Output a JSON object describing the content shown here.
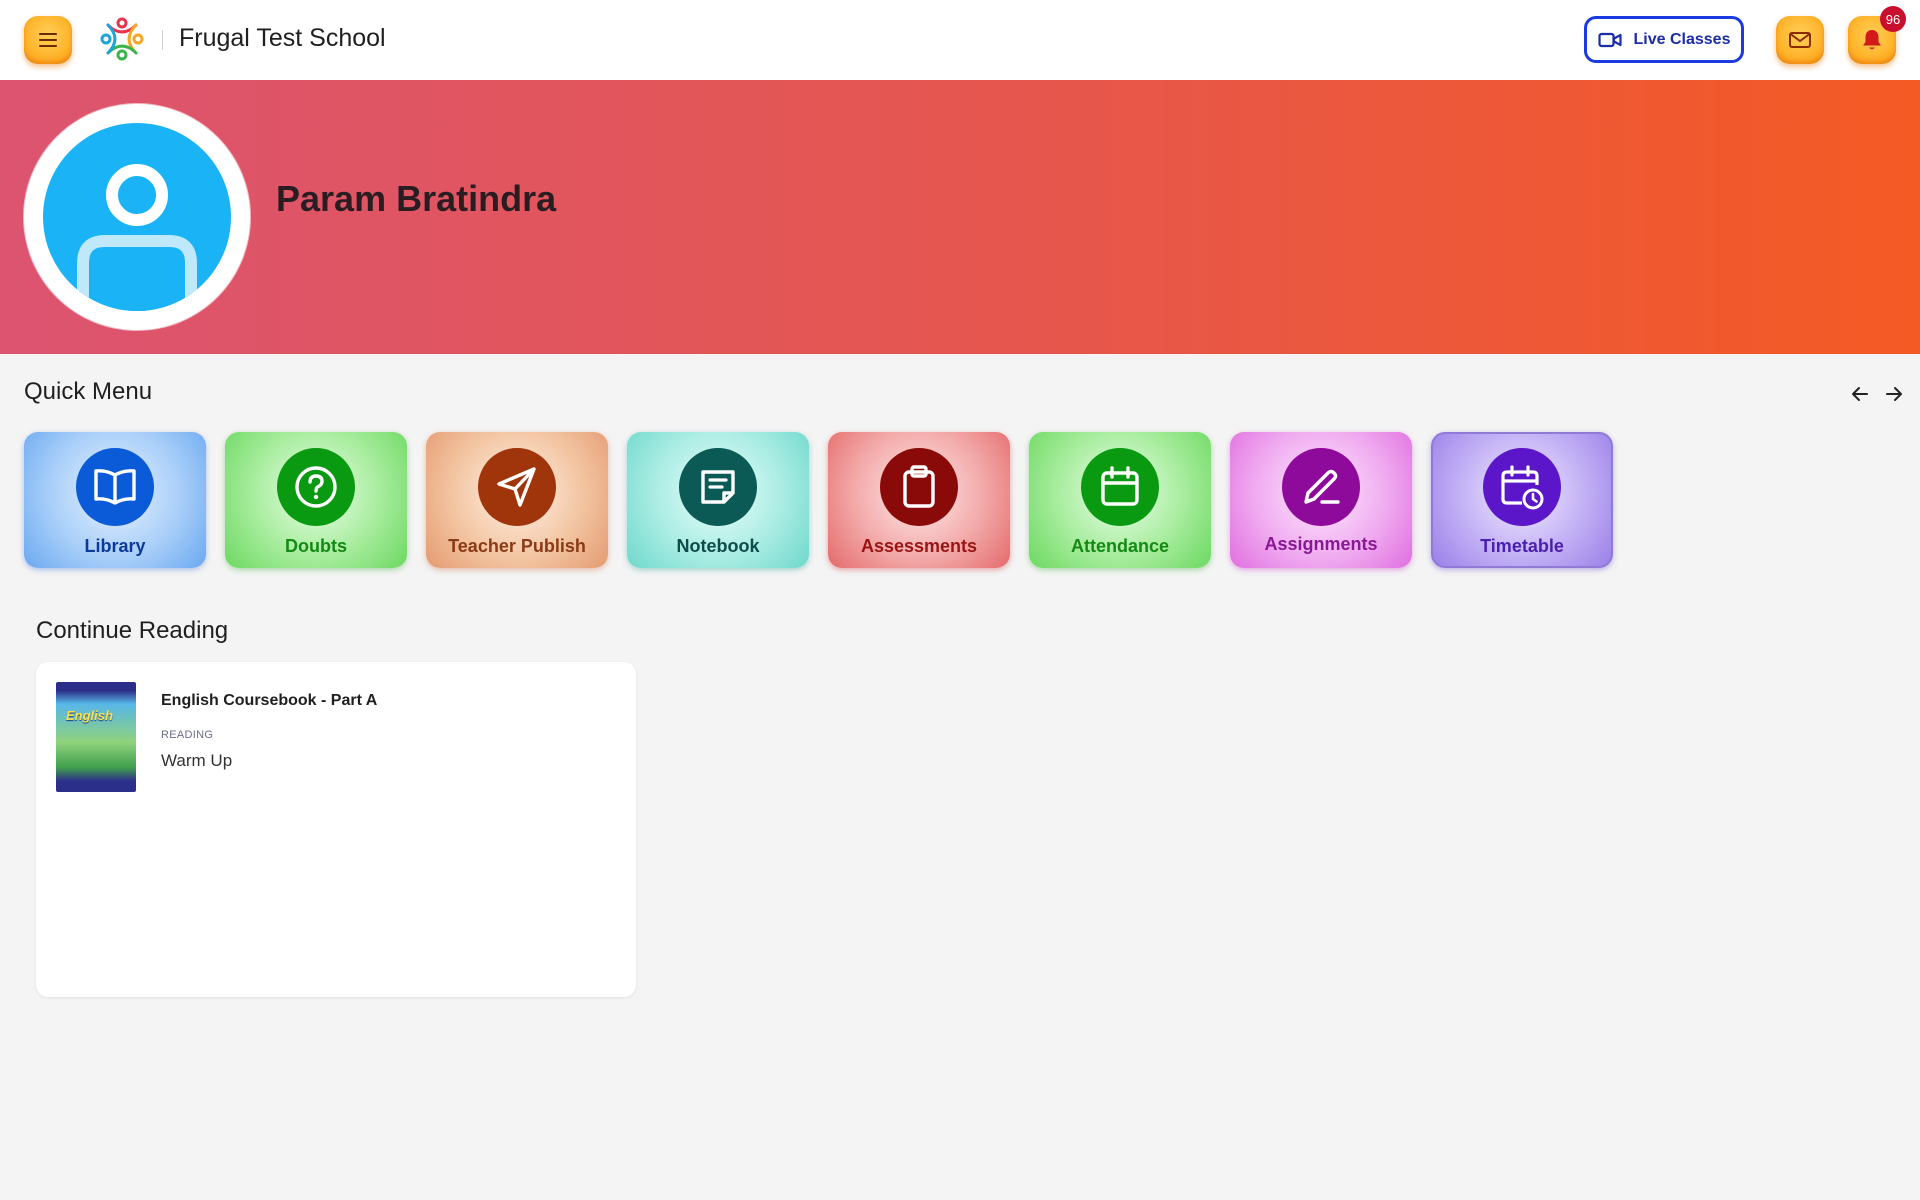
{
  "header": {
    "school_name": "Frugal Test School",
    "live_classes_label": "Live Classes",
    "notification_count": "96",
    "menu_icon": "hamburger-icon",
    "mail_icon": "mail-icon",
    "bell_icon": "bell-icon",
    "accent_color": "#1a3be0",
    "button_color": "#ffb42a"
  },
  "profile": {
    "name": "Param Bratindra",
    "avatar_icon": "user-avatar-icon",
    "banner_gradient": [
      "#dc5470",
      "#f45a24"
    ]
  },
  "quick_menu": {
    "title": "Quick Menu",
    "prev_icon": "arrow-left-icon",
    "next_icon": "arrow-right-icon",
    "items": [
      {
        "label": "Library",
        "icon": "book-icon"
      },
      {
        "label": "Doubts",
        "icon": "question-icon"
      },
      {
        "label": "Teacher Publish",
        "icon": "send-icon"
      },
      {
        "label": "Notebook",
        "icon": "note-icon"
      },
      {
        "label": "Assessments",
        "icon": "clipboard-icon"
      },
      {
        "label": "Attendance",
        "icon": "calendar-icon"
      },
      {
        "label": "Assignments",
        "icon": "pencil-icon"
      },
      {
        "label": "Timetable",
        "icon": "calendar-clock-icon"
      }
    ]
  },
  "continue_reading": {
    "title": "Continue Reading",
    "items": [
      {
        "book_title": "English Coursebook - Part A",
        "kind": "READING",
        "chapter": "Warm Up",
        "cover_text": "English"
      }
    ]
  }
}
